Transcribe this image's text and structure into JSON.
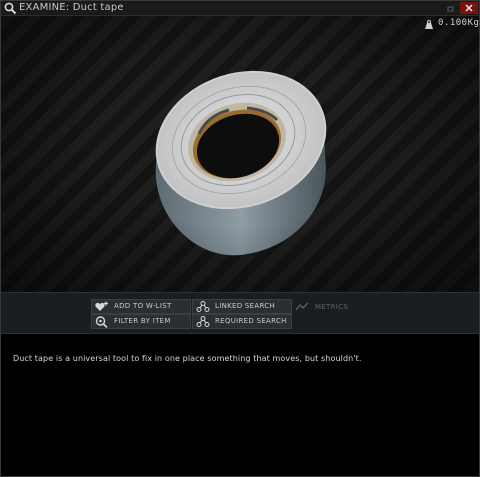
{
  "window": {
    "title": "EXAMINE: Duct tape",
    "title_icon": "magnifier-icon",
    "close_icon": "close-icon"
  },
  "item": {
    "weight": "0.100Kg",
    "weight_icon": "weight-icon",
    "image": "duct-tape-roll"
  },
  "toolbar": {
    "add_wishlist": "ADD TO W-LIST",
    "linked_search": "LINKED SEARCH",
    "metrics": "METRICS",
    "filter_by_item": "FILTER BY ITEM",
    "required_search": "REQUIRED SEARCH"
  },
  "description": "Duct tape is a universal tool to fix in one place something that moves, but shouldn't.",
  "colors": {
    "close_bg": "#7a1212",
    "toolbar_bg": "#1b1e20",
    "button_bg": "#2a2f31"
  }
}
